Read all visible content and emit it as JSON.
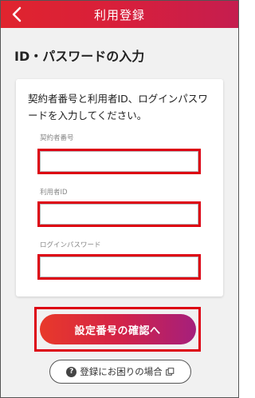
{
  "header": {
    "title": "利用登録",
    "back_icon": "chevron-left-icon"
  },
  "page": {
    "title": "ID・パスワードの入力"
  },
  "card": {
    "instruction": "契約者番号と利用者ID、ログインパスワードを入力してください。",
    "fields": [
      {
        "label": "契約者番号",
        "value": ""
      },
      {
        "label": "利用者ID",
        "value": ""
      },
      {
        "label": "ログインパスワード",
        "value": ""
      }
    ]
  },
  "actions": {
    "confirm_label": "設定番号の確認へ",
    "help_label": "登録にお困りの場合",
    "help_icon": "question-icon",
    "external_icon": "external-link-icon"
  },
  "colors": {
    "header_gradient_start": "#e0242e",
    "header_gradient_end": "#c51e4f",
    "highlight_red": "#dd0012",
    "button_gradient_start": "#e8392a",
    "button_gradient_end": "#a51f7c",
    "background": "#f1f1f1"
  }
}
